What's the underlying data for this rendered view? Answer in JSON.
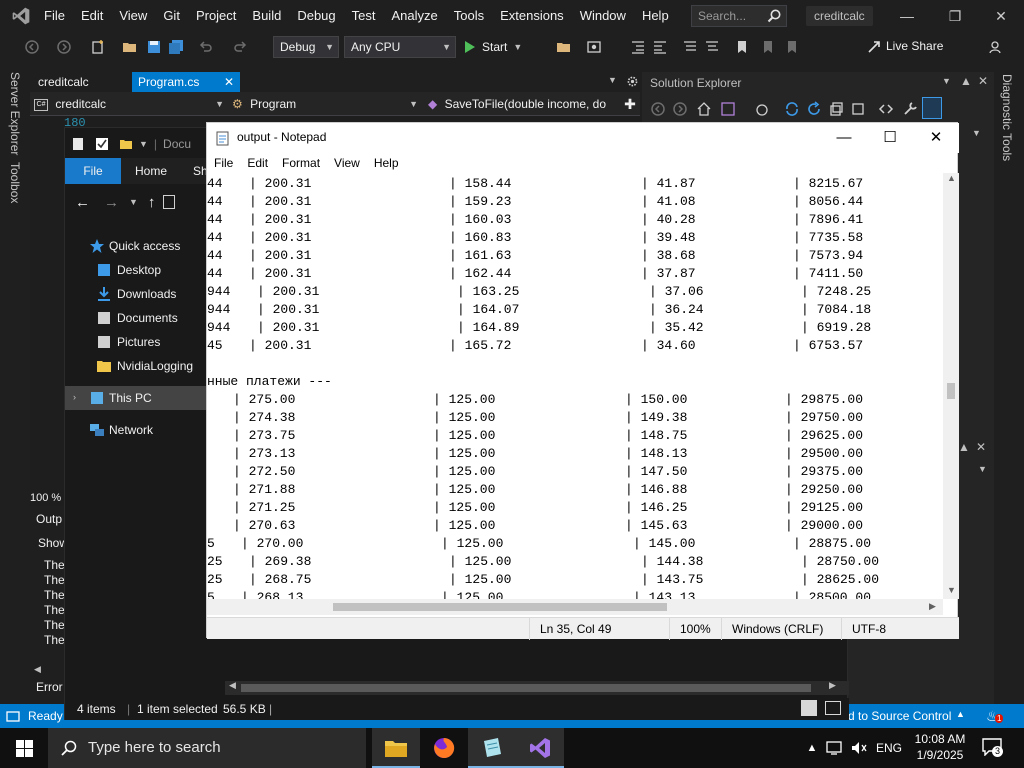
{
  "vs": {
    "menus": [
      "File",
      "Edit",
      "View",
      "Git",
      "Project",
      "Build",
      "Debug",
      "Test",
      "Analyze",
      "Tools",
      "Extensions",
      "Window",
      "Help"
    ],
    "search_placeholder": "Search...",
    "solution_name": "creditcalc",
    "toolbar": {
      "config": "Debug",
      "platform": "Any CPU",
      "start_label": "Start",
      "live_share": "Live Share"
    },
    "left_strip": [
      "Server Explorer",
      "Toolbox"
    ],
    "right_strip": "Diagnostic Tools",
    "tabs": [
      {
        "label": "creditcalc"
      },
      {
        "label": "Program.cs"
      }
    ],
    "nav": {
      "project": "creditcalc",
      "class": "Program",
      "member": "SaveToFile(double income, do"
    },
    "editor_line_number": "180",
    "zoom": "100 %",
    "output": {
      "title": "Outp",
      "show_label": "Show",
      "lines": [
        "The",
        "The",
        "The",
        "The",
        "The",
        "The"
      ],
      "tab_error": "Error"
    },
    "status": {
      "ready": "Ready",
      "source_control": "d to Source Control",
      "notification_count": "1"
    }
  },
  "solution_explorer": {
    "title": "Solution Explorer"
  },
  "explorer": {
    "title_partial": "Docu",
    "ribbon_tabs": [
      "File",
      "Home",
      "Sh"
    ],
    "nav_items": [
      {
        "label": "Quick access",
        "icon": "star-icon"
      },
      {
        "label": "Desktop",
        "icon": "desktop-icon"
      },
      {
        "label": "Downloads",
        "icon": "download-icon"
      },
      {
        "label": "Documents",
        "icon": "document-icon"
      },
      {
        "label": "Pictures",
        "icon": "pictures-icon"
      },
      {
        "label": "NvidiaLogging",
        "icon": "folder-icon"
      },
      {
        "label": "This PC",
        "icon": "computer-icon"
      },
      {
        "label": "Network",
        "icon": "network-icon"
      }
    ],
    "status": {
      "items": "4 items",
      "selected": "1 item selected",
      "size": "56.5 KB"
    }
  },
  "notepad": {
    "title": "output - Notepad",
    "menus": [
      "File",
      "Edit",
      "Format",
      "View",
      "Help"
    ],
    "lines": [
      {
        "cells": [
          "44",
          "| 200.31",
          "| 158.44",
          "| 41.87",
          "| 8215.67"
        ],
        "layout": "a"
      },
      {
        "cells": [
          "44",
          "| 200.31",
          "| 159.23",
          "| 41.08",
          "| 8056.44"
        ],
        "layout": "a"
      },
      {
        "cells": [
          "44",
          "| 200.31",
          "| 160.03",
          "| 40.28",
          "| 7896.41"
        ],
        "layout": "a"
      },
      {
        "cells": [
          "44",
          "| 200.31",
          "| 160.83",
          "| 39.48",
          "| 7735.58"
        ],
        "layout": "a"
      },
      {
        "cells": [
          "44",
          "| 200.31",
          "| 161.63",
          "| 38.68",
          "| 7573.94"
        ],
        "layout": "a"
      },
      {
        "cells": [
          "44",
          "| 200.31",
          "| 162.44",
          "| 37.87",
          "| 7411.50"
        ],
        "layout": "a"
      },
      {
        "cells": [
          "944",
          "| 200.31",
          "| 163.25",
          "| 37.06",
          "| 7248.25"
        ],
        "layout": "b"
      },
      {
        "cells": [
          "944",
          "| 200.31",
          "| 164.07",
          "| 36.24",
          "| 7084.18"
        ],
        "layout": "b"
      },
      {
        "cells": [
          "944",
          "| 200.31",
          "| 164.89",
          "| 35.42",
          "| 6919.28"
        ],
        "layout": "b"
      },
      {
        "cells": [
          "45",
          "| 200.31",
          "| 165.72",
          "| 34.60",
          "| 6753.57"
        ],
        "layout": "a"
      },
      {
        "cells": [
          ""
        ],
        "layout": "blank"
      },
      {
        "cells": [
          "нные платежи ---"
        ],
        "layout": "heading"
      },
      {
        "cells": [
          "",
          "| 275.00",
          "| 125.00",
          "| 150.00",
          "| 29875.00"
        ],
        "layout": "c"
      },
      {
        "cells": [
          "",
          "| 274.38",
          "| 125.00",
          "| 149.38",
          "| 29750.00"
        ],
        "layout": "c"
      },
      {
        "cells": [
          "",
          "| 273.75",
          "| 125.00",
          "| 148.75",
          "| 29625.00"
        ],
        "layout": "c"
      },
      {
        "cells": [
          "",
          "| 273.13",
          "| 125.00",
          "| 148.13",
          "| 29500.00"
        ],
        "layout": "c"
      },
      {
        "cells": [
          "",
          "| 272.50",
          "| 125.00",
          "| 147.50",
          "| 29375.00"
        ],
        "layout": "c"
      },
      {
        "cells": [
          "",
          "| 271.88",
          "| 125.00",
          "| 146.88",
          "| 29250.00"
        ],
        "layout": "c"
      },
      {
        "cells": [
          "",
          "| 271.25",
          "| 125.00",
          "| 146.25",
          "| 29125.00"
        ],
        "layout": "c"
      },
      {
        "cells": [
          "",
          "| 270.63",
          "| 125.00",
          "| 145.63",
          "| 29000.00"
        ],
        "layout": "c"
      },
      {
        "cells": [
          "5",
          "| 270.00",
          "| 125.00",
          "| 145.00",
          "| 28875.00"
        ],
        "layout": "d"
      },
      {
        "cells": [
          "25",
          "| 269.38",
          "| 125.00",
          "| 144.38",
          "| 28750.00"
        ],
        "layout": "e"
      },
      {
        "cells": [
          "25",
          "| 268.75",
          "| 125.00",
          "| 143.75",
          "| 28625.00"
        ],
        "layout": "e"
      },
      {
        "cells": [
          "5",
          "| 268.13",
          "| 125.00",
          "| 143.13",
          "| 28500.00"
        ],
        "layout": "d"
      }
    ],
    "status": {
      "position": "Ln 35, Col 49",
      "zoom": "100%",
      "line_ending": "Windows (CRLF)",
      "encoding": "UTF-8"
    }
  },
  "taskbar": {
    "search_placeholder": "Type here to search",
    "language": "ENG",
    "time": "10:08 AM",
    "date": "1/9/2025",
    "notification_count": "3"
  },
  "colors": {
    "vs_accent": "#007acc",
    "vs_bg": "#1f1f1f",
    "tab_active": "#007acc",
    "explorer_selected": "#0063b1"
  }
}
